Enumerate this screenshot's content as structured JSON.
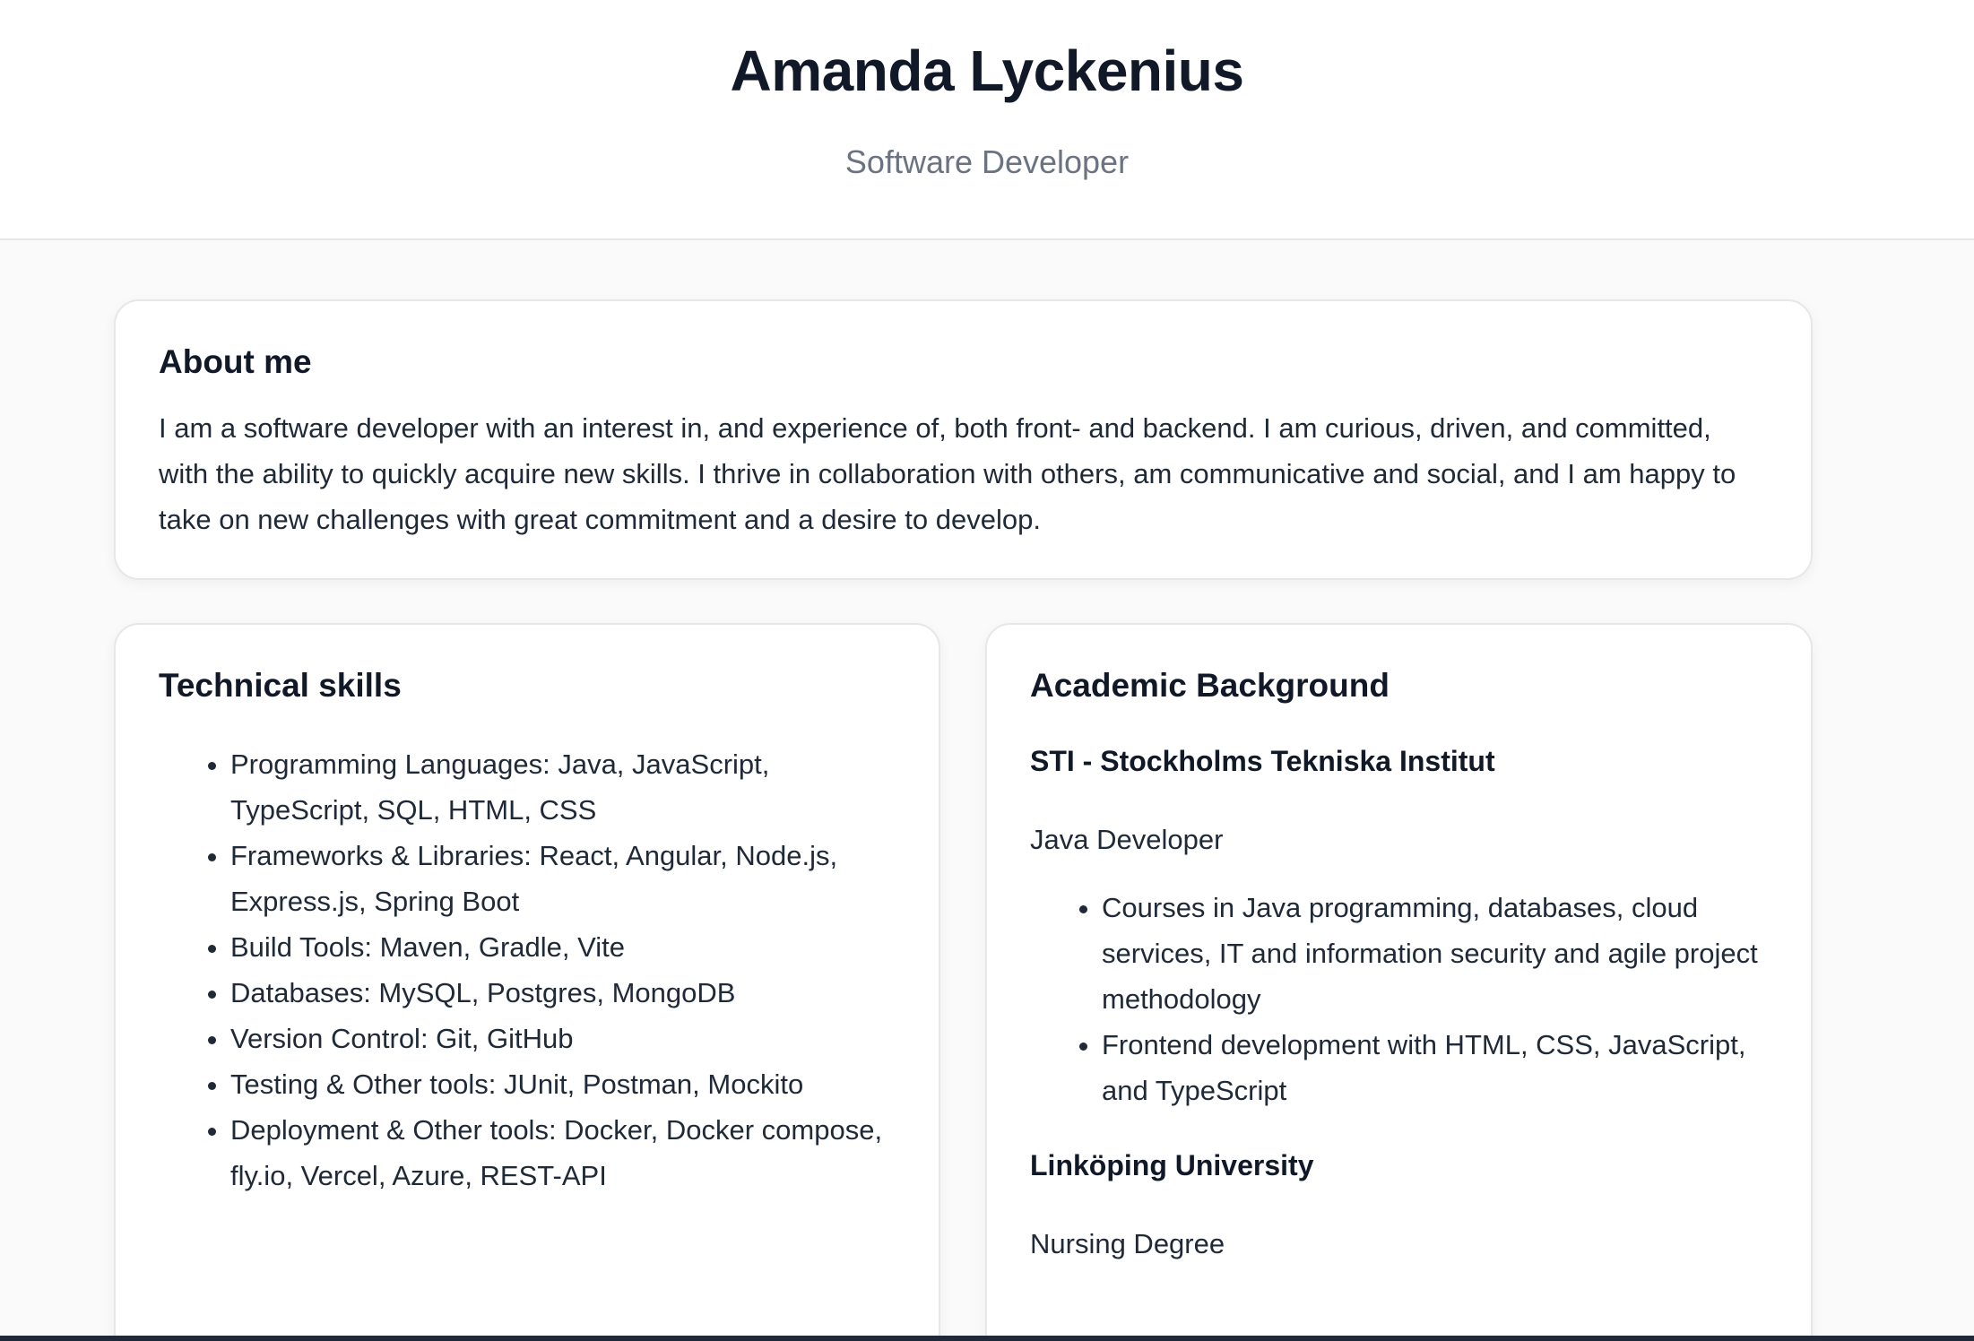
{
  "header": {
    "name": "Amanda Lyckenius",
    "title": "Software Developer"
  },
  "about": {
    "heading": "About me",
    "text": "I am a software developer with an interest in, and experience of, both front- and backend. I am curious, driven, and committed, with the ability to quickly acquire new skills. I thrive in collaboration with others, am communicative and social, and I am happy to take on new challenges with great commitment and a desire to develop."
  },
  "skills": {
    "heading": "Technical skills",
    "items": [
      "Programming Languages: Java, JavaScript, TypeScript, SQL, HTML, CSS",
      "Frameworks & Libraries: React, Angular, Node.js, Express.js, Spring Boot",
      "Build Tools: Maven, Gradle, Vite",
      "Databases: MySQL, Postgres, MongoDB",
      "Version Control: Git, GitHub",
      "Testing & Other tools: JUnit, Postman, Mockito",
      "Deployment & Other tools: Docker, Docker compose, fly.io, Vercel, Azure, REST-API"
    ]
  },
  "academic": {
    "heading": "Academic Background",
    "schools": [
      {
        "name": "STI - Stockholms Tekniska Institut",
        "program": "Java Developer",
        "courses": [
          "Courses in Java programming, databases, cloud services, IT and information security and agile project methodology",
          "Frontend development with HTML, CSS, JavaScript, and TypeScript"
        ]
      },
      {
        "name": "Linköping University",
        "program": "Nursing Degree"
      }
    ]
  }
}
